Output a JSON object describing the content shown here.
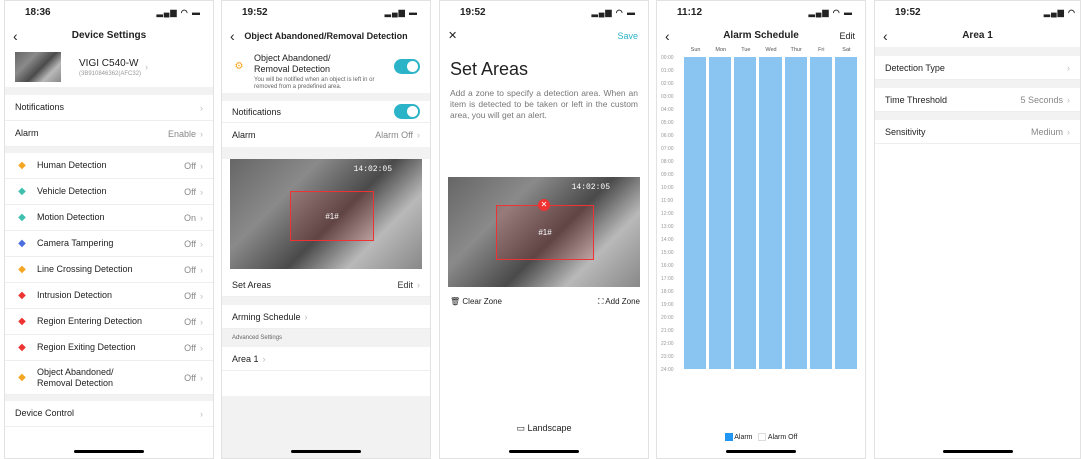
{
  "screen1": {
    "time": "18:36",
    "title": "Device Settings",
    "device_name": "VIGI C540-W",
    "device_id": "(3B910846362(AFC32)",
    "rows": [
      {
        "label": "Notifications",
        "value": ""
      },
      {
        "label": "Alarm",
        "value": "Enable"
      },
      {
        "label": "Human Detection",
        "value": "Off",
        "icon": "human-icon",
        "color": "#f5a623"
      },
      {
        "label": "Vehicle Detection",
        "value": "Off",
        "icon": "vehicle-icon",
        "color": "#3fbfae"
      },
      {
        "label": "Motion Detection",
        "value": "On",
        "icon": "motion-icon",
        "color": "#3fbfae"
      },
      {
        "label": "Camera Tampering",
        "value": "Off",
        "icon": "tamper-icon",
        "color": "#4a6ee0"
      },
      {
        "label": "Line Crossing Detection",
        "value": "Off",
        "icon": "line-cross-icon",
        "color": "#f5a623"
      },
      {
        "label": "Intrusion Detection",
        "value": "Off",
        "icon": "intrusion-icon",
        "color": "#e33"
      },
      {
        "label": "Region Entering Detection",
        "value": "Off",
        "icon": "region-enter-icon",
        "color": "#e33"
      },
      {
        "label": "Region Exiting Detection",
        "value": "Off",
        "icon": "region-exit-icon",
        "color": "#e33"
      },
      {
        "label": "Object Abandoned/\nRemoval Detection",
        "value": "Off",
        "icon": "object-icon",
        "color": "#f5a623"
      },
      {
        "label": "Device Control",
        "value": ""
      }
    ]
  },
  "screen2": {
    "time": "19:52",
    "title": "Object Abandoned/Removal Detection",
    "feature_title": "Object Abandoned/\nRemoval Detection",
    "feature_desc": "You will be notified when an object is left in or removed from a predefined area.",
    "notifications": "Notifications",
    "alarm": "Alarm",
    "alarm_value": "Alarm Off",
    "timestamp": "14:02:05",
    "zone_label": "#1#",
    "set_areas": "Set Areas",
    "edit": "Edit",
    "arming": "Arming Schedule",
    "advanced": "Advanced Settings",
    "area": "Area 1"
  },
  "screen3": {
    "time": "19:52",
    "save": "Save",
    "title": "Set Areas",
    "desc": "Add a zone to specify a detection area. When an item is detected to be taken or left in the custom area, you will get an alert.",
    "timestamp": "14:02:05",
    "zone_label": "#1#",
    "clear": "Clear Zone",
    "add": "Add Zone",
    "landscape": "Landscape"
  },
  "screen4": {
    "time": "11:12",
    "title": "Alarm Schedule",
    "edit": "Edit",
    "days": [
      "Sun",
      "Mon",
      "Tue",
      "Wed",
      "Thur",
      "Fri",
      "Sat"
    ],
    "hours": [
      "00:00",
      "01:00",
      "02:00",
      "03:00",
      "04:00",
      "05:00",
      "06:00",
      "07:00",
      "08:00",
      "09:00",
      "10:00",
      "11:00",
      "12:00",
      "13:00",
      "14:00",
      "15:00",
      "16:00",
      "17:00",
      "18:00",
      "19:00",
      "20:00",
      "21:00",
      "22:00",
      "23:00",
      "24:00"
    ],
    "legend_on": "Alarm",
    "legend_off": "Alarm Off",
    "alarm_color": "#8ac4f0"
  },
  "screen5": {
    "time": "19:52",
    "title": "Area 1",
    "rows": [
      {
        "label": "Detection Type",
        "value": ""
      },
      {
        "label": "Time Threshold",
        "value": "5 Seconds"
      },
      {
        "label": "Sensitivity",
        "value": "Medium"
      }
    ]
  }
}
